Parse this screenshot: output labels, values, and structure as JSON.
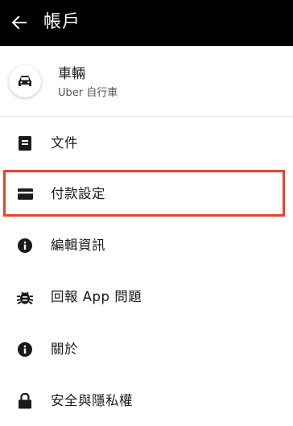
{
  "header": {
    "title": "帳戶",
    "back_icon": "arrow-left-icon"
  },
  "vehicle": {
    "title": "車輛",
    "subtitle": "Uber 自行車",
    "icon": "car-icon"
  },
  "menu": {
    "items": [
      {
        "label": "文件",
        "icon": "document-icon"
      },
      {
        "label": "付款設定",
        "icon": "credit-card-icon"
      },
      {
        "label": "編輯資訊",
        "icon": "info-icon"
      },
      {
        "label": "回報 App 問題",
        "icon": "bug-icon"
      },
      {
        "label": "關於",
        "icon": "info-icon"
      },
      {
        "label": "安全與隱私權",
        "icon": "lock-icon"
      }
    ]
  },
  "colors": {
    "header_bg": "#000000",
    "highlight": "#e8432e",
    "text": "#1a1a1a",
    "subtext": "#555555"
  }
}
